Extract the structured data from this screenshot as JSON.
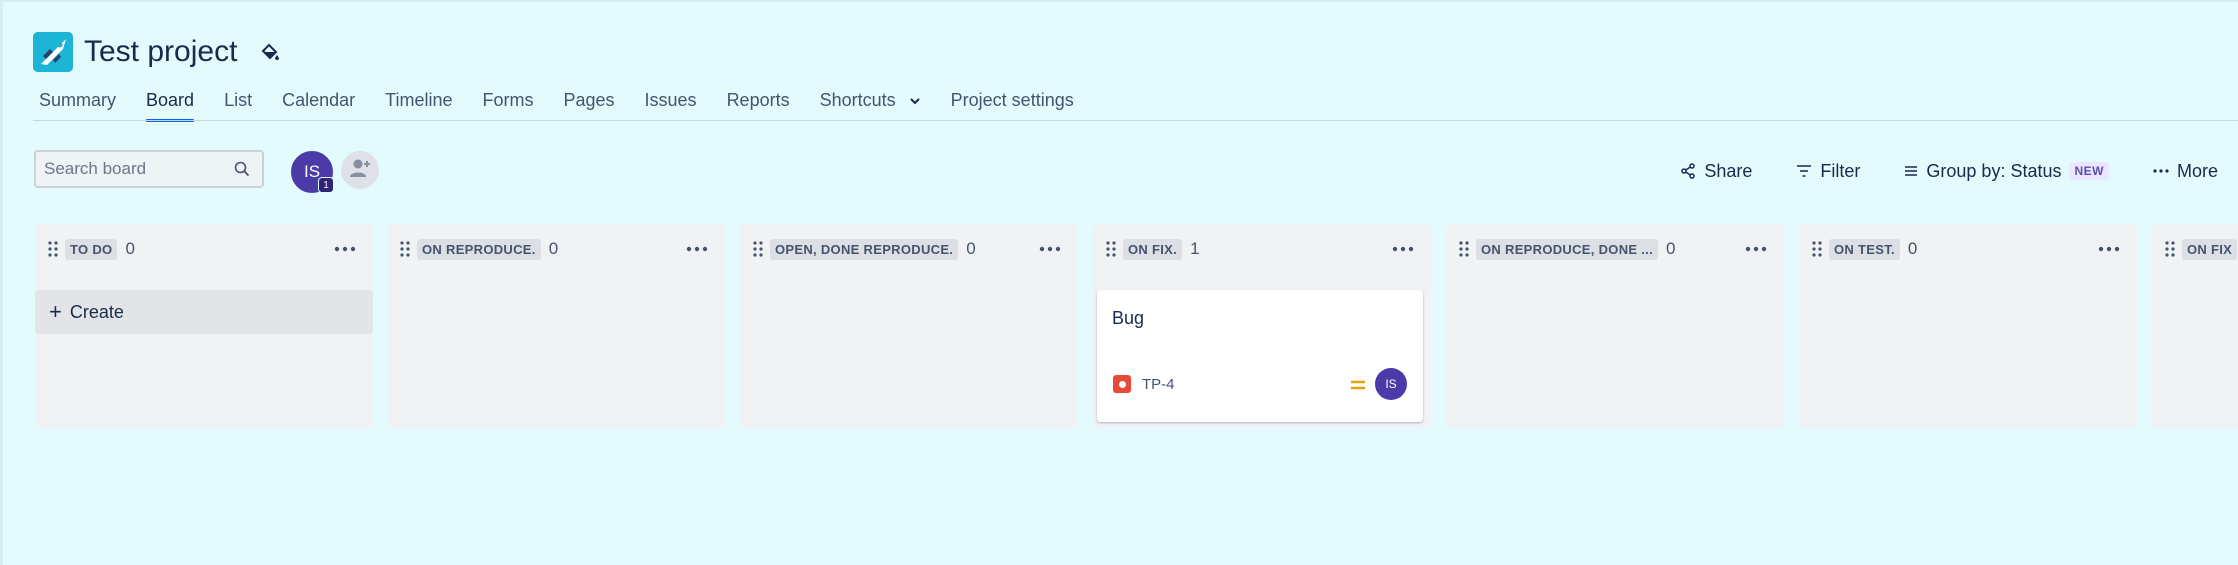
{
  "project": {
    "title": "Test project",
    "logo_icon": "rocket-logo-icon",
    "theme_icon": "paint-bucket-icon"
  },
  "tabs": [
    {
      "label": "Summary",
      "active": false
    },
    {
      "label": "Board",
      "active": true
    },
    {
      "label": "List",
      "active": false
    },
    {
      "label": "Calendar",
      "active": false
    },
    {
      "label": "Timeline",
      "active": false
    },
    {
      "label": "Forms",
      "active": false
    },
    {
      "label": "Pages",
      "active": false
    },
    {
      "label": "Issues",
      "active": false
    },
    {
      "label": "Reports",
      "active": false
    },
    {
      "label": "Shortcuts",
      "active": false,
      "dropdown": true
    },
    {
      "label": "Project settings",
      "active": false
    }
  ],
  "toolbar": {
    "search_placeholder": "Search board",
    "avatar_initials": "IS",
    "avatar_count": "1",
    "actions": {
      "share": "Share",
      "filter": "Filter",
      "group_by": "Group by: Status",
      "group_badge": "NEW",
      "more": "More"
    }
  },
  "columns": [
    {
      "name": "TO DO",
      "count": "0",
      "create_label": "Create"
    },
    {
      "name": "ON REPRODUCE.",
      "count": "0"
    },
    {
      "name": "OPEN, DONE REPRODUCE.",
      "count": "0"
    },
    {
      "name": "ON FIX.",
      "count": "1"
    },
    {
      "name": "ON REPRODUCE, DONE ...",
      "count": "0"
    },
    {
      "name": "ON TEST.",
      "count": "0"
    },
    {
      "name": "ON FIX",
      "count": ""
    }
  ],
  "card": {
    "title": "Bug",
    "key": "TP-4",
    "type_icon": "bug-type-icon",
    "priority_icon": "medium-priority-icon",
    "assignee_initials": "IS"
  },
  "colors": {
    "background": "#e3fbfd",
    "accent": "#0c66e4",
    "avatar": "#4b3ba8",
    "bug": "#e5493a",
    "priority_medium": "#e2a30b"
  }
}
